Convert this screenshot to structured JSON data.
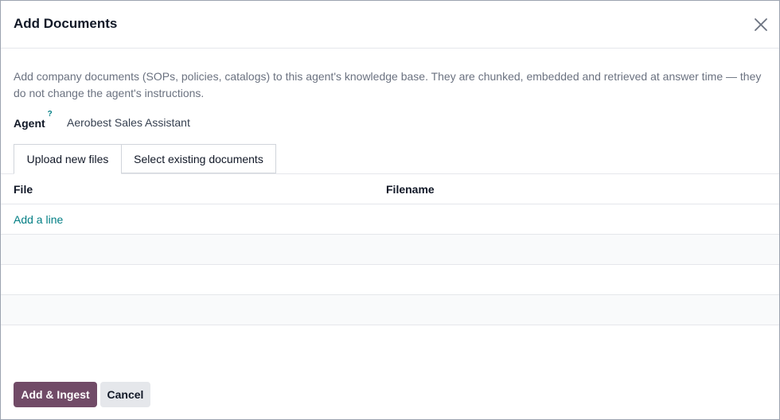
{
  "dialog": {
    "title": "Add Documents",
    "close_icon": "close-icon"
  },
  "description": "Add company documents (SOPs, policies, catalogs) to this agent's knowledge base. They are chunked, embedded and retrieved at answer time — they do not change the agent's instructions.",
  "agent": {
    "label": "Agent",
    "help": "?",
    "value": "Aerobest Sales Assistant"
  },
  "tabs": [
    {
      "label": "Upload new files",
      "active": true
    },
    {
      "label": "Select existing documents",
      "active": false
    }
  ],
  "table": {
    "columns": [
      "File",
      "Filename"
    ],
    "add_line": "Add a line",
    "rows": []
  },
  "footer": {
    "primary_label": "Add & Ingest",
    "secondary_label": "Cancel"
  },
  "colors": {
    "primary": "#714b67",
    "link": "#017e84",
    "secondary_bg": "#e5e7eb"
  }
}
